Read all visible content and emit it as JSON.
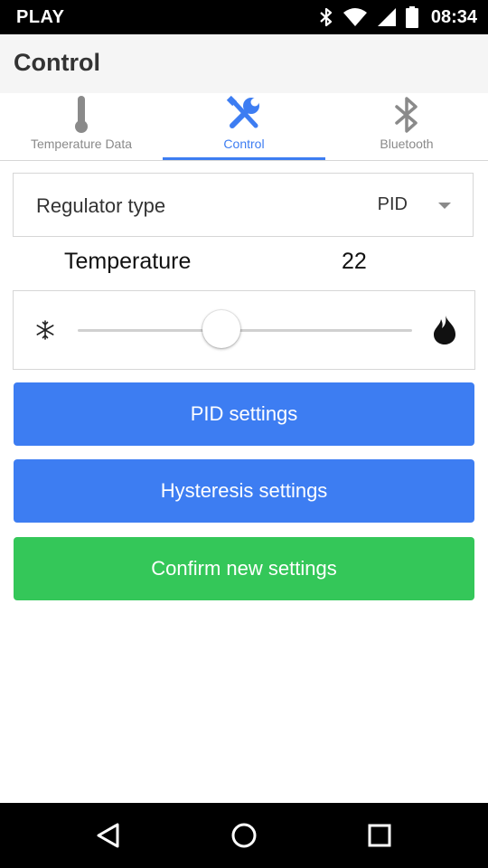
{
  "status_bar": {
    "carrier": "PLAY",
    "time": "08:34",
    "icons": [
      "bluetooth-icon",
      "wifi-icon",
      "signal-icon",
      "battery-icon"
    ]
  },
  "app_bar": {
    "title": "Control"
  },
  "tabs": [
    {
      "label": "Temperature Data",
      "icon": "thermometer-icon",
      "active": false
    },
    {
      "label": "Control",
      "icon": "tools-icon",
      "active": true
    },
    {
      "label": "Bluetooth",
      "icon": "bluetooth-icon",
      "active": false
    }
  ],
  "regulator": {
    "label": "Regulator type",
    "value": "PID"
  },
  "temperature": {
    "label": "Temperature",
    "value": "22"
  },
  "slider": {
    "level_fraction": 0.43,
    "left_icon": "snowflake-icon",
    "right_icon": "flame-icon"
  },
  "buttons": {
    "pid_settings": "PID settings",
    "hysteresis_settings": "Hysteresis settings",
    "confirm": "Confirm new settings"
  },
  "colors": {
    "accent": "#3d7df2",
    "confirm": "#34c759",
    "tab_inactive": "#8a8a8a"
  },
  "nav_bar": {
    "icons": [
      "back-icon",
      "home-icon",
      "recents-icon"
    ]
  }
}
